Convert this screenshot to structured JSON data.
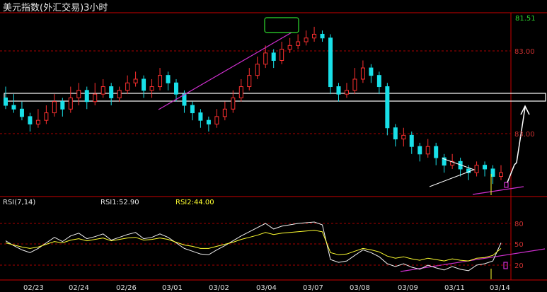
{
  "window": {
    "title": "美元指数(外汇交易)3小时"
  },
  "price_axis": {
    "labels": [
      "83.00",
      "83.00"
    ],
    "current": "81.51"
  },
  "rsi": {
    "name": "RSI(7,14)",
    "rsi1_label": "RSI1:52.90",
    "rsi2_label": "RSI2:44.00",
    "axis_labels": [
      "80",
      "50",
      "20"
    ]
  },
  "x_axis": {
    "labels": [
      "02/23",
      "02/24",
      "02/26",
      "03/01",
      "03/02",
      "03/04",
      "03/07",
      "03/08",
      "03/09",
      "03/11",
      "03/14"
    ]
  },
  "colors": {
    "up": "#ff3030",
    "down": "#19e0e8",
    "grid": "#aa0000",
    "frame": "#cc0000",
    "trend": "#d02fd0",
    "rsi1": "#f2f2f2",
    "rsi2": "#ffff30",
    "box": "#2fdc2f",
    "text_yellow": "#ffff30"
  },
  "chart_data": {
    "type": "candlestick",
    "series": [
      {
        "values": [
          [
            84.6,
            84.4,
            84.9,
            84.3
          ],
          [
            84.4,
            84.3,
            84.7,
            84.2
          ],
          [
            84.3,
            84.1,
            84.5,
            84.0
          ],
          [
            84.1,
            83.9,
            84.2,
            83.7
          ],
          [
            83.9,
            84.0,
            84.3,
            83.8
          ],
          [
            84.0,
            84.2,
            84.4,
            83.9
          ],
          [
            84.2,
            84.5,
            84.7,
            84.1
          ],
          [
            84.5,
            84.3,
            84.6,
            84.1
          ],
          [
            84.3,
            84.6,
            84.9,
            84.2
          ],
          [
            84.6,
            84.8,
            85.0,
            84.4
          ],
          [
            84.8,
            84.5,
            84.9,
            84.3
          ],
          [
            84.5,
            84.7,
            85.0,
            84.4
          ],
          [
            84.7,
            84.9,
            85.1,
            84.6
          ],
          [
            84.9,
            84.6,
            85.0,
            84.4
          ],
          [
            84.6,
            84.8,
            84.9,
            84.5
          ],
          [
            84.8,
            85.0,
            85.2,
            84.7
          ],
          [
            85.0,
            85.1,
            85.3,
            84.9
          ],
          [
            85.1,
            84.8,
            85.2,
            84.6
          ],
          [
            84.8,
            84.9,
            85.1,
            84.6
          ],
          [
            84.9,
            85.2,
            85.4,
            84.8
          ],
          [
            85.2,
            85.0,
            85.3,
            84.8
          ],
          [
            85.0,
            84.7,
            85.1,
            84.5
          ],
          [
            84.7,
            84.4,
            84.8,
            84.2
          ],
          [
            84.4,
            84.2,
            84.5,
            84.0
          ],
          [
            84.2,
            84.0,
            84.3,
            83.8
          ],
          [
            84.0,
            83.9,
            84.1,
            83.7
          ],
          [
            83.9,
            84.1,
            84.3,
            83.8
          ],
          [
            84.1,
            84.3,
            84.5,
            84.0
          ],
          [
            84.3,
            84.6,
            84.8,
            84.2
          ],
          [
            84.6,
            84.9,
            85.1,
            84.5
          ],
          [
            84.9,
            85.2,
            85.4,
            84.8
          ],
          [
            85.2,
            85.5,
            85.7,
            85.1
          ],
          [
            85.5,
            85.8,
            86.0,
            85.4
          ],
          [
            85.8,
            85.6,
            85.9,
            85.4
          ],
          [
            85.6,
            85.9,
            86.1,
            85.5
          ],
          [
            85.9,
            86.0,
            86.2,
            85.8
          ],
          [
            86.0,
            86.1,
            86.3,
            85.9
          ],
          [
            86.1,
            86.2,
            86.4,
            86.0
          ],
          [
            86.2,
            86.3,
            86.5,
            86.1
          ],
          [
            86.3,
            86.2,
            86.4,
            86.1
          ],
          [
            86.2,
            84.9,
            86.3,
            84.7
          ],
          [
            84.9,
            84.7,
            85.0,
            84.5
          ],
          [
            84.7,
            84.8,
            85.0,
            84.6
          ],
          [
            84.8,
            85.1,
            85.4,
            84.7
          ],
          [
            85.1,
            85.4,
            85.6,
            85.0
          ],
          [
            85.4,
            85.2,
            85.5,
            85.0
          ],
          [
            85.2,
            84.9,
            85.3,
            84.7
          ],
          [
            84.9,
            83.8,
            85.0,
            83.6
          ],
          [
            83.8,
            83.5,
            83.9,
            83.3
          ],
          [
            83.5,
            83.6,
            83.8,
            83.3
          ],
          [
            83.6,
            83.3,
            83.7,
            83.1
          ],
          [
            83.3,
            83.1,
            83.4,
            82.9
          ],
          [
            83.1,
            83.3,
            83.5,
            83.0
          ],
          [
            83.3,
            83.0,
            83.4,
            82.8
          ],
          [
            83.0,
            82.8,
            83.1,
            82.6
          ],
          [
            82.8,
            82.9,
            83.1,
            82.7
          ],
          [
            82.9,
            82.7,
            83.0,
            82.5
          ],
          [
            82.7,
            82.6,
            82.8,
            82.4
          ],
          [
            82.6,
            82.8,
            82.9,
            82.5
          ],
          [
            82.8,
            82.7,
            82.9,
            82.5
          ],
          [
            82.7,
            82.5,
            82.8,
            82.3
          ],
          [
            82.5,
            82.6,
            82.8,
            82.4
          ]
        ]
      }
    ],
    "y_right_labels": [
      "83.00",
      "83.00",
      "81.51"
    ],
    "x_labels": [
      "02/23",
      "02/24",
      "02/26",
      "03/01",
      "03/02",
      "03/04",
      "03/07",
      "03/08",
      "03/09",
      "03/11",
      "03/14"
    ],
    "rsi_series": [
      {
        "name": "RSI1",
        "values": [
          55,
          48,
          42,
          38,
          44,
          52,
          60,
          54,
          62,
          66,
          58,
          61,
          65,
          56,
          60,
          64,
          67,
          58,
          60,
          65,
          60,
          52,
          44,
          40,
          36,
          35,
          42,
          48,
          55,
          62,
          68,
          74,
          80,
          72,
          76,
          78,
          80,
          81,
          82,
          78,
          28,
          24,
          26,
          34,
          42,
          38,
          32,
          22,
          18,
          22,
          17,
          14,
          20,
          16,
          13,
          18,
          14,
          12,
          20,
          22,
          26,
          52
        ]
      },
      {
        "name": "RSI2",
        "values": [
          52,
          49,
          46,
          44,
          46,
          50,
          54,
          52,
          56,
          58,
          55,
          57,
          59,
          55,
          57,
          59,
          60,
          56,
          57,
          59,
          57,
          53,
          49,
          47,
          44,
          44,
          47,
          50,
          53,
          57,
          60,
          63,
          67,
          64,
          66,
          67,
          68,
          69,
          70,
          68,
          38,
          35,
          36,
          40,
          44,
          42,
          39,
          33,
          30,
          32,
          29,
          27,
          30,
          28,
          26,
          29,
          27,
          26,
          30,
          31,
          34,
          44
        ]
      }
    ],
    "rsi_axis": [
      80,
      50,
      20
    ],
    "grid": true,
    "legend": "top-left"
  }
}
